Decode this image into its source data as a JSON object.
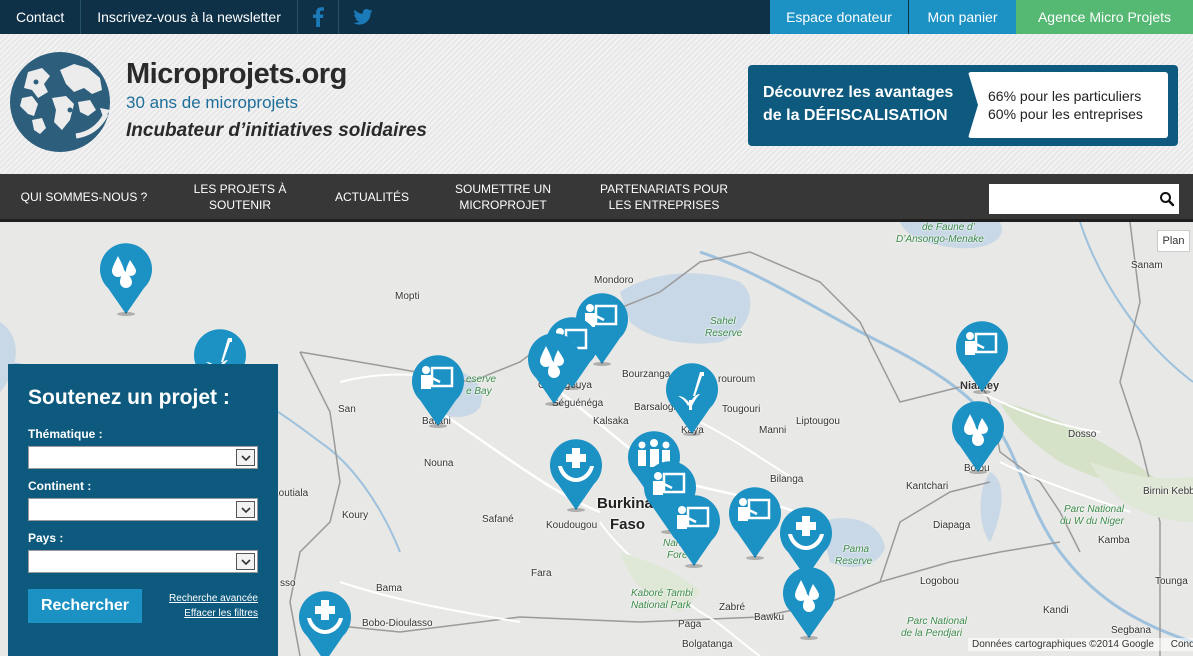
{
  "topbar": {
    "links": [
      "Contact",
      "Inscrivez-vous à la newsletter"
    ],
    "social": [
      "facebook-icon",
      "twitter-icon"
    ],
    "buttons": {
      "donor": "Espace donateur",
      "cart": "Mon panier",
      "agency": "Agence Micro Projets"
    },
    "colors": {
      "bar": "#0e3148",
      "blue": "#1b91c4",
      "green": "#55b873"
    }
  },
  "header": {
    "title": "Microprojets.org",
    "subtitle": "30 ans de microprojets",
    "tagline": "Incubateur d’initiatives solidaires",
    "tax": {
      "line1": "Découvrez les avantages",
      "line2": "de la DÉFISCALISATION",
      "right1": "66% pour les particuliers",
      "right2": "60% pour les entreprises"
    }
  },
  "nav": {
    "items": [
      "QUI SOMMES-NOUS ?",
      "LES PROJETS À SOUTENIR",
      "ACTUALITÉS",
      "SOUMETTRE UN MICROPROJET",
      "PARTENARIATS POUR LES ENTREPRISES"
    ],
    "search_placeholder": ""
  },
  "map": {
    "plan_button": "Plan",
    "attribution": "Données cartographiques ©2014 Google",
    "attribution_cut": "Condi",
    "places": {
      "faune1": "de Faune d’",
      "faune2": "D’Ansongo-Menake",
      "sanam": "Sanam",
      "mondoro": "Mondoro",
      "mopti": "Mopti",
      "sahel1": "Sahel",
      "sahel2": "Reserve",
      "bourzanga": "Bourzanga",
      "bourzanga_suffix": "rouroum",
      "niamey": "Niamey",
      "reserve": "eserve",
      "bay": "e Bay",
      "ouahigouya": "Ouahigouya",
      "seguenega": "Séguénéga",
      "san": "San",
      "barsalogho": "Barsalogho",
      "tougouri": "Tougouri",
      "kalsaka": "Kalsaka",
      "bani": "Barani",
      "kaya": "Kaya",
      "manni": "Manni",
      "liptougou": "Liptougou",
      "dosso": "Dosso",
      "bolou": "Bolou",
      "nouna": "Nouna",
      "bilanga": "Bilanga",
      "kantchari": "Kantchari",
      "birnin": "Birnin Kebbi",
      "koutiala": "Koutiala",
      "burkina": "Burkina",
      "faso": "Faso",
      "koury": "Koury",
      "safane": "Safané",
      "koudougou": "Koudougou",
      "diapaga": "Diapaga",
      "parc_w1": "Parc National",
      "parc_w2": "du W du Niger",
      "kamba": "Kamba",
      "nahouri1": "Nah",
      "nahouri2": "Fore",
      "pama1": "Pama",
      "pama2": "Reserve",
      "fara": "Fara",
      "logobou": "Logobou",
      "tounga": "Tounga",
      "bama": "Bama",
      "kabore1": "Kaboré Tambi",
      "kabore2": "National Park",
      "zabre": "Zabré",
      "kandi": "Kandi",
      "bobo": "Bobo-Dioulasso",
      "bawku": "Bawku",
      "pendjari1": "Parc National",
      "pendjari2": "de la Pendjari",
      "paga": "Paga",
      "segbana": "Segbana",
      "bolgatanga": "Bolgatanga",
      "sso": "sso"
    }
  },
  "panel": {
    "title": "Soutenez un projet :",
    "thematique_label": "Thématique :",
    "continent_label": "Continent :",
    "pays_label": "Pays :",
    "thematique_value": "",
    "continent_value": "",
    "pays_value": "",
    "search_button": "Rechercher",
    "advanced_link": "Recherche avancée",
    "clear_link": "Effacer les filtres"
  }
}
